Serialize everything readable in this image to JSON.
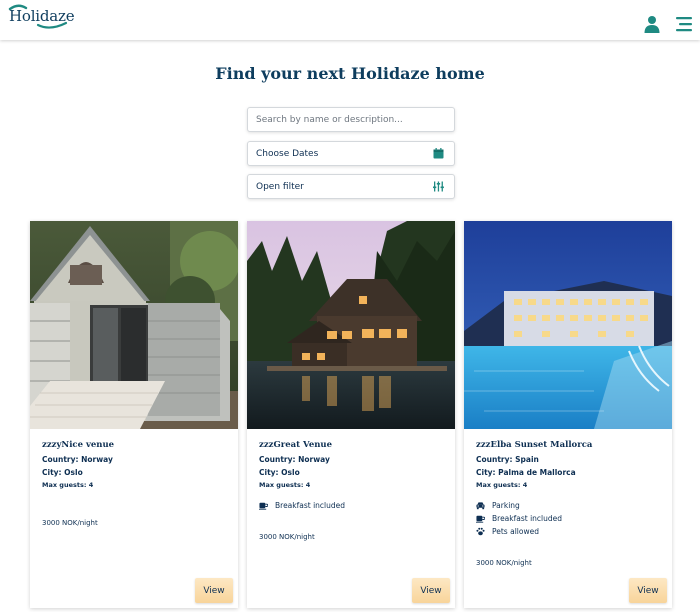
{
  "header": {
    "logo": "Holidaze",
    "icons": [
      "user-icon",
      "hamburger-menu-icon"
    ],
    "brand_color": "#0e3d5e",
    "accent_color": "#1f8a82"
  },
  "main": {
    "title": "Find your next Holidaze home",
    "search_placeholder": "Search by name or description...",
    "dates_label": "Choose Dates",
    "filter_label": "Open filter"
  },
  "venues": [
    {
      "name": "zzzyNice venue",
      "country": "Country: Norway",
      "city": "City: Oslo",
      "guests": "Max guests: 4",
      "amenities": [],
      "price": "3000 NOK/night",
      "button": "View"
    },
    {
      "name": "zzzGreat Venue",
      "country": "Country: Norway",
      "city": "City: Oslo",
      "guests": "Max guests: 4",
      "amenities": [
        {
          "icon": "coffee-cup-icon",
          "label": "Breakfast included"
        }
      ],
      "price": "3000 NOK/night",
      "button": "View"
    },
    {
      "name": "zzzElba Sunset Mallorca",
      "country": "Country: Spain",
      "city": "City: Palma de Mallorca",
      "guests": "Max guests: 4",
      "amenities": [
        {
          "icon": "car-icon",
          "label": "Parking"
        },
        {
          "icon": "coffee-cup-icon",
          "label": "Breakfast included"
        },
        {
          "icon": "paw-icon",
          "label": "Pets allowed"
        }
      ],
      "price": "3000 NOK/night",
      "button": "View"
    }
  ]
}
